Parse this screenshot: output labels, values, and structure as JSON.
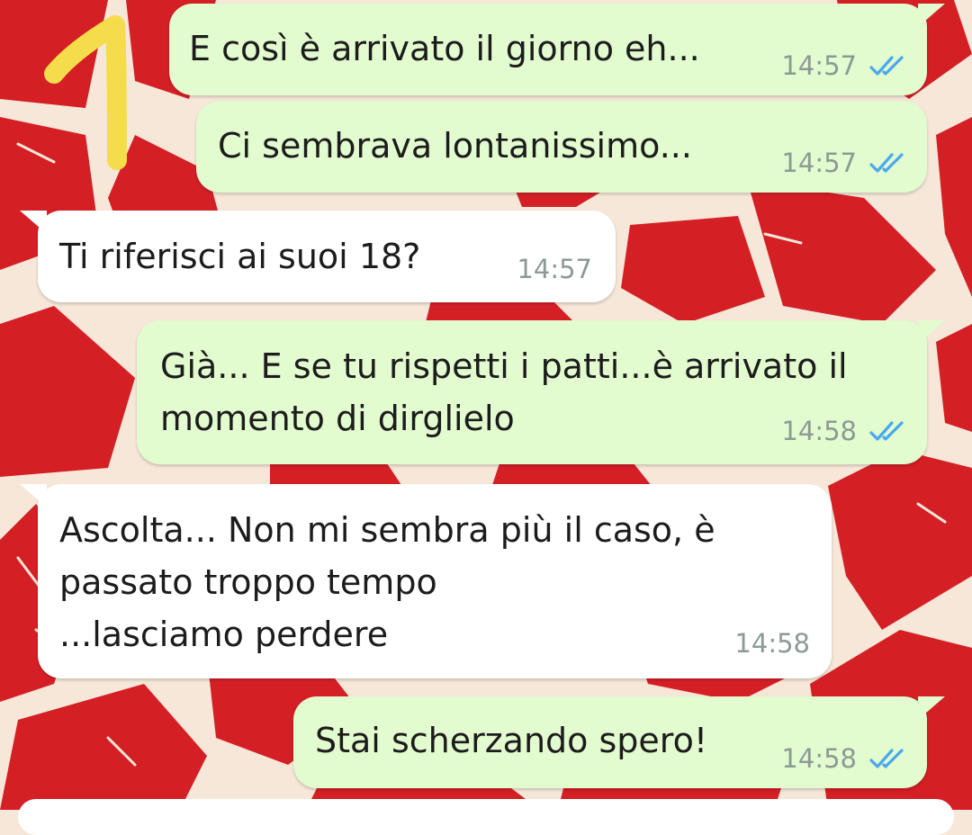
{
  "annotation_label": "1",
  "messages": [
    {
      "direction": "outgoing",
      "lines": [
        "E così è arrivato il giorno eh..."
      ],
      "time": "14:57",
      "status_icon": "double-check-icon"
    },
    {
      "direction": "outgoing",
      "lines": [
        "Ci sembrava lontanissimo..."
      ],
      "time": "14:57",
      "status_icon": "double-check-icon"
    },
    {
      "direction": "incoming",
      "lines": [
        "Ti riferisci ai suoi 18?"
      ],
      "time": "14:57"
    },
    {
      "direction": "outgoing",
      "lines": [
        "Già... E se tu rispetti i patti...è arrivato il",
        "momento di dirglielo"
      ],
      "time": "14:58",
      "status_icon": "double-check-icon"
    },
    {
      "direction": "incoming",
      "lines": [
        "Ascolta... Non mi sembra più il caso, è",
        "passato troppo tempo",
        "...lasciamo perdere"
      ],
      "time": "14:58"
    },
    {
      "direction": "outgoing",
      "lines": [
        "Stai scherzando spero!"
      ],
      "time": "14:58",
      "status_icon": "double-check-icon"
    }
  ],
  "colors": {
    "wallpaper_red": "#d41f25",
    "wallpaper_cream": "#f6e7d8",
    "outgoing_bubble": "#e2fbcf",
    "incoming_bubble": "#ffffff",
    "read_ticks": "#4aa8ee",
    "annotation_yellow": "#f5dc4a"
  }
}
